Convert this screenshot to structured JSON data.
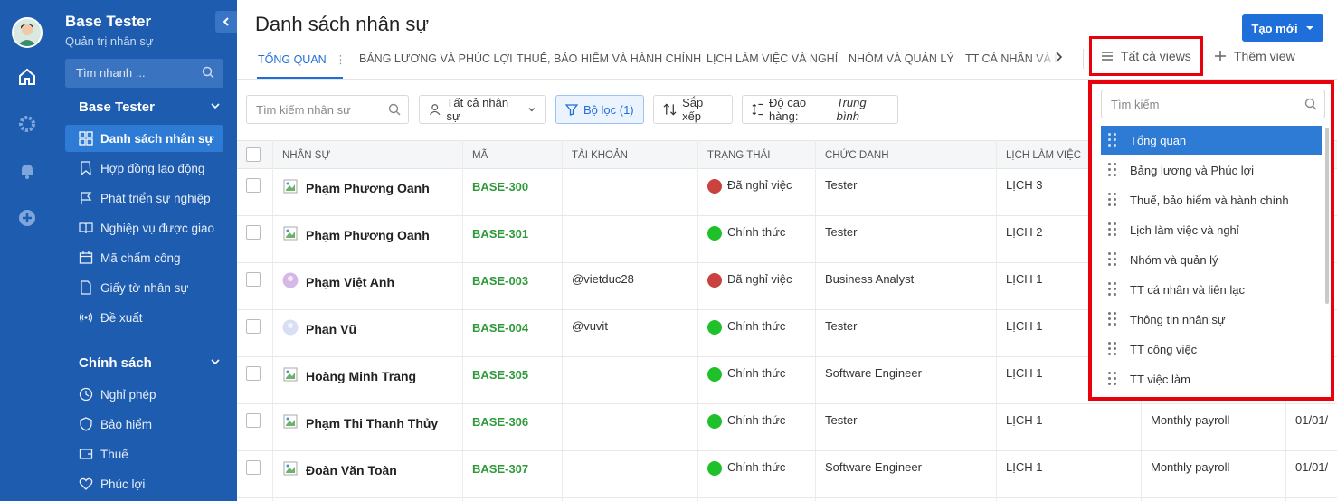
{
  "sidebar": {
    "title": "Base Tester",
    "subtitle": "Quản trị nhân sự",
    "search_placeholder": "Tìm nhanh ...",
    "group1": "Base Tester",
    "items1": [
      {
        "label": "Danh sách nhân sự",
        "icon": "grid-icon"
      },
      {
        "label": "Hợp đồng lao động",
        "icon": "contract-icon"
      },
      {
        "label": "Phát triển sự nghiệp",
        "icon": "flag-icon"
      },
      {
        "label": "Nghiệp vụ được giao",
        "icon": "book-icon"
      },
      {
        "label": "Mã chấm công",
        "icon": "calendar-icon"
      },
      {
        "label": "Giấy tờ nhân sự",
        "icon": "document-icon"
      },
      {
        "label": "Đề xuất",
        "icon": "broadcast-icon"
      }
    ],
    "group2": "Chính sách",
    "items2": [
      {
        "label": "Nghỉ phép",
        "icon": "clock-icon"
      },
      {
        "label": "Bảo hiểm",
        "icon": "shield-icon"
      },
      {
        "label": "Thuế",
        "icon": "wallet-icon"
      },
      {
        "label": "Phúc lợi",
        "icon": "heart-icon"
      }
    ]
  },
  "header": {
    "title": "Danh sách nhân sự",
    "create_button": "Tạo mới",
    "all_views": "Tất cả views",
    "add_view": "Thêm view"
  },
  "tabs": [
    "TỔNG QUAN",
    "BẢNG LƯƠNG VÀ PHÚC LỢI",
    "THUẾ, BẢO HIỂM VÀ HÀNH CHÍNH",
    "LỊCH LÀM VIỆC VÀ NGHỈ",
    "NHÓM VÀ QUẢN LÝ",
    "TT CÁ NHÂN VÀ L"
  ],
  "toolbar": {
    "search_placeholder": "Tìm kiếm nhân sự",
    "all_staff": "Tất cả nhân sự",
    "filter": "Bộ lọc (1)",
    "sort": "Sắp xếp",
    "row_height_label": "Độ cao hàng:",
    "row_height_value": "Trung bình"
  },
  "table": {
    "columns": [
      "NHÂN SỰ",
      "MÃ",
      "TÀI KHOẢN",
      "TRẠNG THÁI",
      "CHỨC DANH",
      "LỊCH LÀM VIỆC"
    ],
    "rows": [
      {
        "name": "Phạm Phương Oanh",
        "code": "BASE-300",
        "account": "",
        "status": "Đã nghỉ việc",
        "status_color": "#c9423f",
        "title": "Tester",
        "schedule": "LỊCH 3",
        "payroll": "",
        "date": ""
      },
      {
        "name": "Phạm Phương Oanh",
        "code": "BASE-301",
        "account": "",
        "status": "Chính thức",
        "status_color": "#1fc12a",
        "title": "Tester",
        "schedule": "LỊCH 2",
        "payroll": "",
        "date": ""
      },
      {
        "name": "Phạm Việt Anh",
        "code": "BASE-003",
        "account": "@vietduc28",
        "status": "Đã nghỉ việc",
        "status_color": "#c9423f",
        "title": "Business Analyst",
        "schedule": "LỊCH 1",
        "payroll": "",
        "date": ""
      },
      {
        "name": "Phan Vũ",
        "code": "BASE-004",
        "account": "@vuvit",
        "status": "Chính thức",
        "status_color": "#1fc12a",
        "title": "Tester",
        "schedule": "LỊCH 1",
        "payroll": "",
        "date": ""
      },
      {
        "name": "Hoàng Minh Trang",
        "code": "BASE-305",
        "account": "",
        "status": "Chính thức",
        "status_color": "#1fc12a",
        "title": "Software Engineer",
        "schedule": "LỊCH 1",
        "payroll": "",
        "date": ""
      },
      {
        "name": "Phạm Thi Thanh Thủy",
        "code": "BASE-306",
        "account": "",
        "status": "Chính thức",
        "status_color": "#1fc12a",
        "title": "Tester",
        "schedule": "LỊCH 1",
        "payroll": "Monthly payroll",
        "date": "01/01/"
      },
      {
        "name": "Đoàn Văn Toàn",
        "code": "BASE-307",
        "account": "",
        "status": "Chính thức",
        "status_color": "#1fc12a",
        "title": "Software Engineer",
        "schedule": "LỊCH 1",
        "payroll": "Monthly payroll",
        "date": "01/01/"
      }
    ]
  },
  "views_dropdown": {
    "search_placeholder": "Tìm kiếm",
    "items": [
      "Tổng quan",
      "Bảng lương và Phúc lợi",
      "Thuế, bảo hiểm và hành chính",
      "Lịch làm việc và nghỉ",
      "Nhóm và quản lý",
      "TT cá nhân và liên lạc",
      "Thông tin nhân sự",
      "TT công việc",
      "TT việc làm"
    ]
  }
}
